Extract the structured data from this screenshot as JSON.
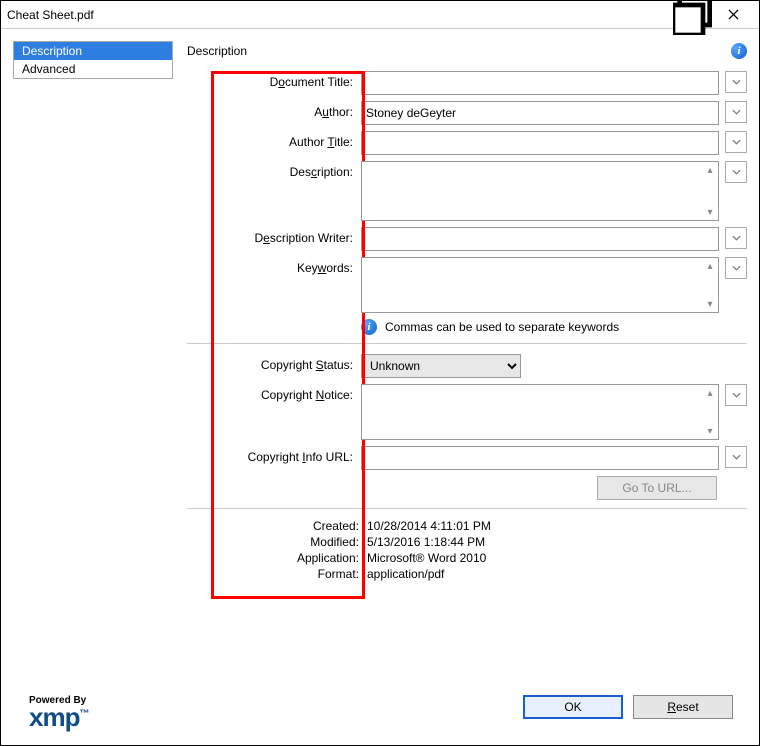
{
  "window": {
    "title": "Cheat Sheet.pdf"
  },
  "sidebar": {
    "items": [
      {
        "label": "Description",
        "selected": true
      },
      {
        "label": "Advanced",
        "selected": false
      }
    ]
  },
  "powered_by": {
    "label": "Powered By",
    "brand": "xmp"
  },
  "panel": {
    "title": "Description"
  },
  "fields": {
    "document_title": {
      "label_pre": "D",
      "label_mid": "o",
      "label_post": "cument Title:",
      "value": ""
    },
    "author": {
      "label_pre": "A",
      "label_mid": "u",
      "label_post": "thor:",
      "value": "Stoney deGeyter"
    },
    "author_title": {
      "label_pre": "Author ",
      "label_mid": "T",
      "label_post": "itle:",
      "value": ""
    },
    "description": {
      "label_pre": "Des",
      "label_mid": "c",
      "label_post": "ription:",
      "value": ""
    },
    "description_writer": {
      "label_pre": "D",
      "label_mid": "e",
      "label_post": "scription Writer:",
      "value": ""
    },
    "keywords": {
      "label_pre": "Key",
      "label_mid": "w",
      "label_post": "ords:",
      "value": ""
    },
    "keywords_hint": "Commas can be used to separate keywords",
    "copyright_status": {
      "label_pre": "Copyright ",
      "label_mid": "S",
      "label_post": "tatus:",
      "value": "Unknown"
    },
    "copyright_notice": {
      "label_pre": "Copyright ",
      "label_mid": "N",
      "label_post": "otice:",
      "value": ""
    },
    "copyright_info_url": {
      "label_pre": "Copyright ",
      "label_mid": "I",
      "label_post": "nfo URL:",
      "value": ""
    },
    "go_to_url": "Go To URL..."
  },
  "meta": {
    "created": {
      "label": "Created:",
      "value": "10/28/2014 4:11:01 PM"
    },
    "modified": {
      "label": "Modified:",
      "value": "5/13/2016 1:18:44 PM"
    },
    "application": {
      "label": "Application:",
      "value": "Microsoft® Word 2010"
    },
    "format": {
      "label": "Format:",
      "value": "application/pdf"
    }
  },
  "buttons": {
    "ok": "OK",
    "reset": "Reset"
  }
}
